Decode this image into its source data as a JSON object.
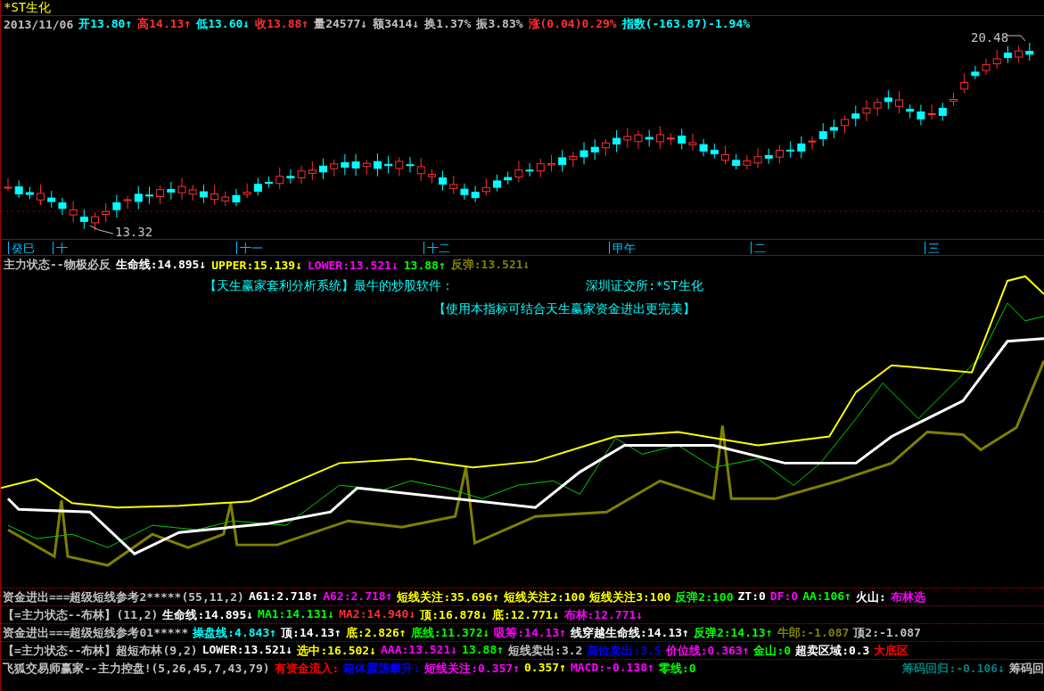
{
  "stock": {
    "title": "*ST生化"
  },
  "quote": [
    {
      "text": "2013/11/06",
      "color": "#c0c0c0"
    },
    {
      "text": "开13.80↑",
      "color": "#00ffff"
    },
    {
      "text": "高14.13↑",
      "color": "#ff3030"
    },
    {
      "text": "低13.60↓",
      "color": "#00ffff"
    },
    {
      "text": "收13.88↑",
      "color": "#ff3030"
    },
    {
      "text": "量24577↓",
      "color": "#c0c0c0"
    },
    {
      "text": "额3414↓",
      "color": "#c0c0c0"
    },
    {
      "text": "换1.37%",
      "color": "#c0c0c0"
    },
    {
      "text": "振3.83%",
      "color": "#c0c0c0"
    },
    {
      "text": "涨(0.04)0.29%",
      "color": "#ff3030"
    },
    {
      "text": "指数(-163.87)-1.94%",
      "color": "#00ffff"
    }
  ],
  "price_chart": {
    "high_label": "20.48",
    "low_label": "13.32"
  },
  "time_axis": [
    "癸巳",
    "十",
    "十一",
    "十二",
    "甲午",
    "二",
    "三"
  ],
  "indicator": {
    "values": [
      {
        "text": "主力状态--物极必反",
        "color": "#c0c0c0"
      },
      {
        "text": "生命线:14.895↓",
        "color": "#ffffff"
      },
      {
        "text": "UPPER:15.139↓",
        "color": "#ffff00"
      },
      {
        "text": "LOWER:13.521↓",
        "color": "#ff00ff"
      },
      {
        "text": "13.88↑",
        "color": "#00ff00"
      },
      {
        "text": "反弹:13.521↓",
        "color": "#808000"
      }
    ],
    "notes": [
      "【天生赢家套利分析系统】最牛的炒股软件：",
      "深圳证交所:*ST生化",
      "【使用本指标可结合天生赢家资金进出更完美】"
    ]
  },
  "formula_rows": [
    {
      "segments": [
        {
          "text": "资金进出===超级短线参考2*****(55,11,2)",
          "color": "#c0c0c0"
        },
        {
          "text": "A61:2.718↑",
          "color": "#ffffff"
        },
        {
          "text": "A62:2.718↑",
          "color": "#ff00ff"
        },
        {
          "text": "短线关注:35.696↑",
          "color": "#ffff00"
        },
        {
          "text": "短线关注2:100",
          "color": "#ffff00"
        },
        {
          "text": "短线关注3:100",
          "color": "#ffff00"
        },
        {
          "text": "反弹2:100",
          "color": "#00ff00"
        },
        {
          "text": "ZT:0",
          "color": "#ffffff"
        },
        {
          "text": "DF:0",
          "color": "#ff00ff"
        },
        {
          "text": "AA:106↑",
          "color": "#00ff00"
        },
        {
          "text": "火山:",
          "color": "#ffffff"
        },
        {
          "text": "布林选",
          "color": "#ff00ff"
        }
      ]
    },
    {
      "segments": [
        {
          "text": "【=主力状态--布林】(11,2)",
          "color": "#c0c0c0"
        },
        {
          "text": "生命线:14.895↓",
          "color": "#ffffff"
        },
        {
          "text": "MA1:14.131↓",
          "color": "#00ff00"
        },
        {
          "text": "MA2:14.940↓",
          "color": "#ff3030"
        },
        {
          "text": "顶:16.878↓",
          "color": "#ffff00"
        },
        {
          "text": "底:12.771↓",
          "color": "#ffff00"
        },
        {
          "text": "布林:12.771↓",
          "color": "#ff00ff"
        }
      ]
    },
    {
      "segments": [
        {
          "text": "资金进出===超级短线参考01*****",
          "color": "#c0c0c0"
        },
        {
          "text": "操盘线:4.843↑",
          "color": "#00ffff"
        },
        {
          "text": "顶:14.13↑",
          "color": "#ffffff"
        },
        {
          "text": "底:2.826↑",
          "color": "#ffff00"
        },
        {
          "text": "底线:11.372↓",
          "color": "#00ff00"
        },
        {
          "text": "吸筹:14.13↑",
          "color": "#ff00ff"
        },
        {
          "text": "线穿越生命线:14.13↑",
          "color": "#ffffff"
        },
        {
          "text": "反弹2:14.13↑",
          "color": "#00ff00"
        },
        {
          "text": "牛郎:-1.087",
          "color": "#808000"
        },
        {
          "text": "顶2:-1.087",
          "color": "#c0c0c0"
        }
      ]
    },
    {
      "segments": [
        {
          "text": "【=主力状态--布林】超短布林(9,2)",
          "color": "#c0c0c0"
        },
        {
          "text": "LOWER:13.521↓",
          "color": "#ffffff"
        },
        {
          "text": "选中:16.502↓",
          "color": "#ffff00"
        },
        {
          "text": "AAA:13.521↓",
          "color": "#ff00ff"
        },
        {
          "text": "13.88↑",
          "color": "#00ff00"
        },
        {
          "text": "短线卖出:3.2",
          "color": "#c0c0c0"
        },
        {
          "text": "高位卖出:3.5",
          "color": "#0000ff"
        },
        {
          "text": "价位线:0.363↑",
          "color": "#ff00ff"
        },
        {
          "text": "金山:0",
          "color": "#00ff00"
        },
        {
          "text": "超卖区域:0.3",
          "color": "#ffffff"
        },
        {
          "text": "大底区",
          "color": "#ff0000"
        }
      ]
    },
    {
      "segments": [
        {
          "text": "飞狐交易师赢家--主力控盘!(5,26,45,7,43,79)",
          "color": "#c0c0c0"
        },
        {
          "text": "有资金流入:",
          "color": "#ff0000"
        },
        {
          "text": "箱体震荡攀升:",
          "color": "#0000ff"
        },
        {
          "text": "短线关注:0.357↑",
          "color": "#ff00ff"
        },
        {
          "text": "0.357↑",
          "color": "#ffff00"
        },
        {
          "text": "MACD:-0.138↑",
          "color": "#ff00ff"
        },
        {
          "text": "零线:0",
          "color": "#00ff00"
        }
      ],
      "right_segments": [
        {
          "text": "筹码回归:-0.106↓",
          "color": "#008080"
        },
        {
          "text": "筹码回",
          "color": "#c0c0c0"
        }
      ]
    }
  ]
}
